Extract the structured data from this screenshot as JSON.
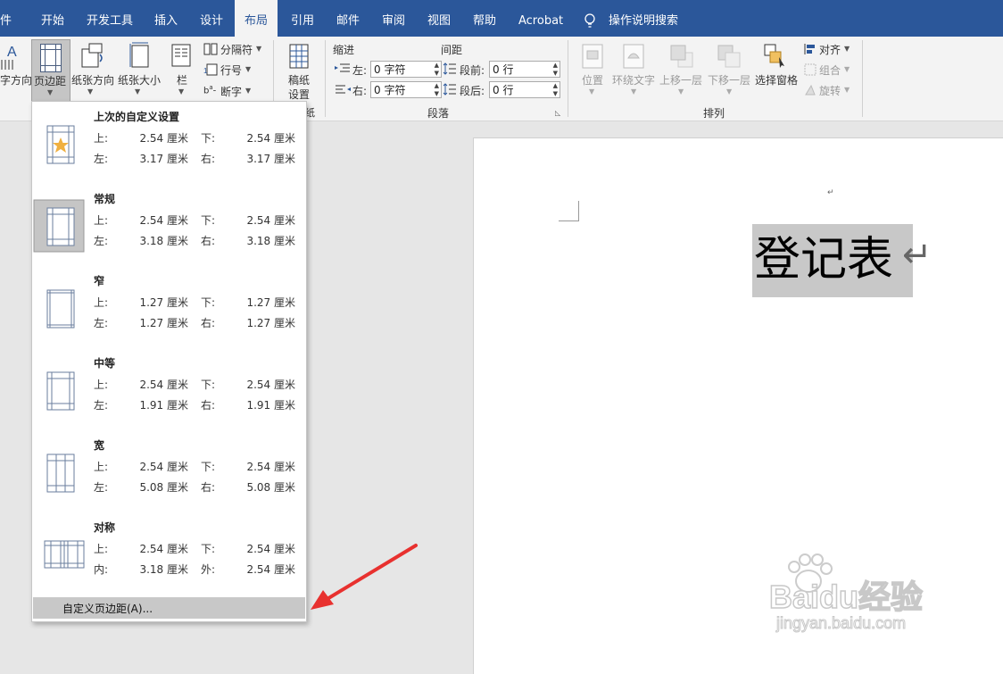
{
  "menubar": {
    "tabs": [
      "文件",
      "开始",
      "开发工具",
      "插入",
      "设计",
      "布局",
      "引用",
      "邮件",
      "审阅",
      "视图",
      "帮助",
      "Acrobat"
    ],
    "file_tab_visible": "件",
    "active_tab": "布局",
    "tell_me": "操作说明搜索"
  },
  "ribbon": {
    "text_direction": "字方向",
    "margins": "页边距",
    "orientation": "纸张方向",
    "size": "纸张大小",
    "columns": "栏",
    "breaks": "分隔符",
    "line_numbers": "行号",
    "hyphenation": "断字",
    "draft_paper_1": "稿纸",
    "draft_paper_2": "设置",
    "group_page_setup_tail": "纸",
    "indent_title": "缩进",
    "spacing_title": "间距",
    "indent_left_label": "左:",
    "indent_left_value": "0 字符",
    "indent_right_label": "右:",
    "indent_right_value": "0 字符",
    "space_before_label": "段前:",
    "space_before_value": "0 行",
    "space_after_label": "段后:",
    "space_after_value": "0 行",
    "paragraph_group": "段落",
    "position": "位置",
    "wrap_text": "环绕文字",
    "bring_forward": "上移一层",
    "send_backward": "下移一层",
    "selection_pane": "选择窗格",
    "align": "对齐",
    "group": "组合",
    "rotate": "旋转",
    "arrange_group": "排列"
  },
  "margins_menu": {
    "options": [
      {
        "name": "上次的自定义设置",
        "k1": "上:",
        "v1": "2.54 厘米",
        "k2": "下:",
        "v2": "2.54 厘米",
        "k3": "左:",
        "v3": "3.17 厘米",
        "k4": "右:",
        "v4": "3.17 厘米"
      },
      {
        "name": "常规",
        "k1": "上:",
        "v1": "2.54 厘米",
        "k2": "下:",
        "v2": "2.54 厘米",
        "k3": "左:",
        "v3": "3.18 厘米",
        "k4": "右:",
        "v4": "3.18 厘米"
      },
      {
        "name": "窄",
        "k1": "上:",
        "v1": "1.27 厘米",
        "k2": "下:",
        "v2": "1.27 厘米",
        "k3": "左:",
        "v3": "1.27 厘米",
        "k4": "右:",
        "v4": "1.27 厘米"
      },
      {
        "name": "中等",
        "k1": "上:",
        "v1": "2.54 厘米",
        "k2": "下:",
        "v2": "2.54 厘米",
        "k3": "左:",
        "v3": "1.91 厘米",
        "k4": "右:",
        "v4": "1.91 厘米"
      },
      {
        "name": "宽",
        "k1": "上:",
        "v1": "2.54 厘米",
        "k2": "下:",
        "v2": "2.54 厘米",
        "k3": "左:",
        "v3": "5.08 厘米",
        "k4": "右:",
        "v4": "5.08 厘米"
      },
      {
        "name": "对称",
        "k1": "上:",
        "v1": "2.54 厘米",
        "k2": "下:",
        "v2": "2.54 厘米",
        "k3": "内:",
        "v3": "3.18 厘米",
        "k4": "外:",
        "v4": "2.54 厘米"
      }
    ],
    "custom": "自定义页边距(A)..."
  },
  "document": {
    "title": "登记表",
    "return_mark": "↵"
  },
  "watermark": {
    "brand": "Baidu经验",
    "url": "jingyan.baidu.com"
  },
  "colors": {
    "menubar": "#2b579a",
    "arrow": "#e8312f",
    "selection": "#c8c8c8"
  }
}
